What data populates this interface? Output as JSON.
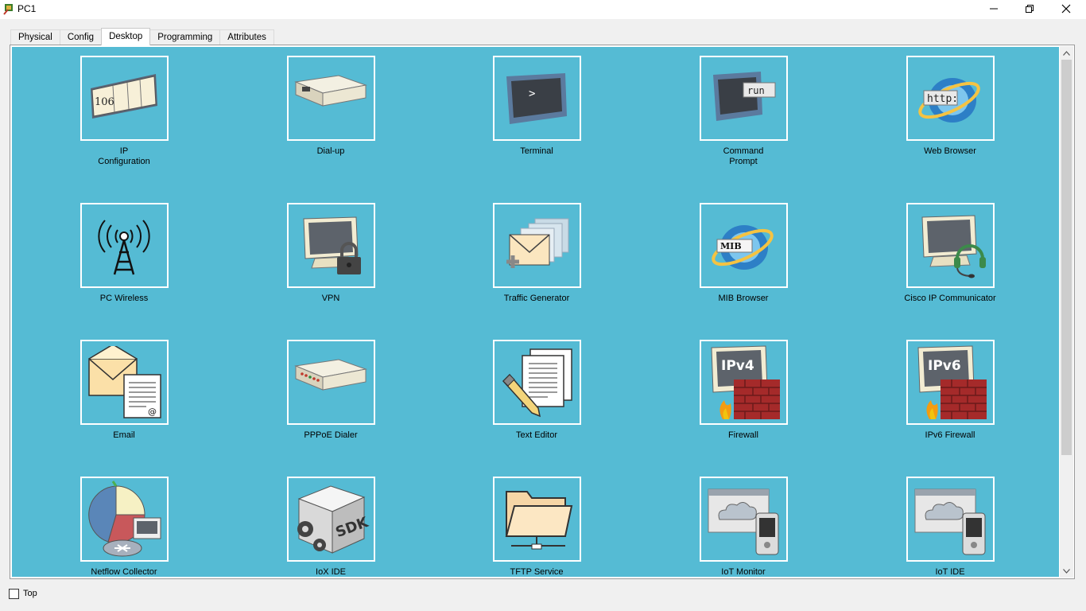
{
  "window": {
    "title": "PC1"
  },
  "tabs": [
    "Physical",
    "Config",
    "Desktop",
    "Programming",
    "Attributes"
  ],
  "active_tab": "Desktop",
  "apps": [
    {
      "label": "IP\nConfiguration",
      "icon": "ip-configuration-icon",
      "badge": "106"
    },
    {
      "label": "Dial-up",
      "icon": "modem-icon"
    },
    {
      "label": "Terminal",
      "icon": "terminal-icon",
      "badge": ">"
    },
    {
      "label": "Command\nPrompt",
      "icon": "command-prompt-icon",
      "badge": "run"
    },
    {
      "label": "Web Browser",
      "icon": "web-browser-icon",
      "badge": "http:"
    },
    {
      "label": "PC Wireless",
      "icon": "wireless-tower-icon"
    },
    {
      "label": "VPN",
      "icon": "vpn-monitor-lock-icon"
    },
    {
      "label": "Traffic Generator",
      "icon": "traffic-generator-icon"
    },
    {
      "label": "MIB Browser",
      "icon": "mib-browser-icon",
      "badge": "MIB"
    },
    {
      "label": "Cisco IP Communicator",
      "icon": "ip-communicator-icon"
    },
    {
      "label": "Email",
      "icon": "email-icon",
      "badge": "@"
    },
    {
      "label": "PPPoE Dialer",
      "icon": "pppoe-modem-icon"
    },
    {
      "label": "Text Editor",
      "icon": "text-editor-icon"
    },
    {
      "label": "Firewall",
      "icon": "ipv4-firewall-icon",
      "badge": "IPv4"
    },
    {
      "label": "IPv6 Firewall",
      "icon": "ipv6-firewall-icon",
      "badge": "IPv6"
    },
    {
      "label": "Netflow Collector",
      "icon": "netflow-collector-icon"
    },
    {
      "label": "IoX IDE",
      "icon": "iox-sdk-icon",
      "badge": "SDK"
    },
    {
      "label": "TFTP Service",
      "icon": "tftp-folder-icon"
    },
    {
      "label": "IoT Monitor",
      "icon": "iot-monitor-icon"
    },
    {
      "label": "IoT IDE",
      "icon": "iot-ide-icon"
    }
  ],
  "bottom": {
    "top_checkbox_label": "Top",
    "top_checked": false
  },
  "colors": {
    "desktop_bg": "#55bbd4"
  }
}
